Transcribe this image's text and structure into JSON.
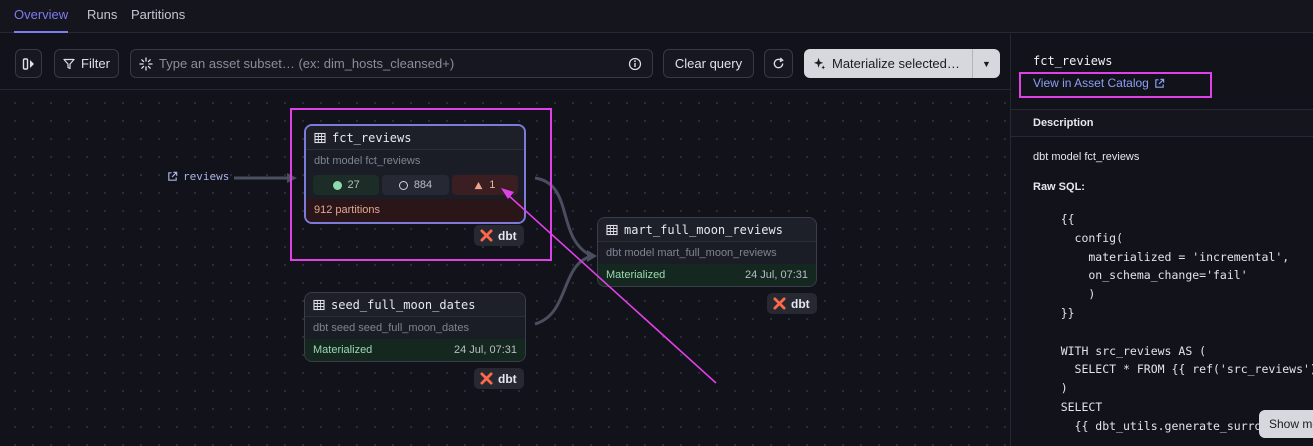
{
  "tabs": [
    {
      "label": "Overview",
      "active": true
    },
    {
      "label": "Runs",
      "active": false
    },
    {
      "label": "Partitions",
      "active": false
    }
  ],
  "toolbar": {
    "filter_label": "Filter",
    "search_placeholder": "Type an asset subset… (ex: dim_hosts_cleansed+)",
    "clear_label": "Clear query",
    "materialize_label": "Materialize selected…"
  },
  "graph": {
    "external_source": "reviews",
    "nodes": {
      "fct_reviews": {
        "name": "fct_reviews",
        "description": "dbt model fct_reviews",
        "stat_success": "27",
        "stat_missing": "884",
        "stat_failed": "1",
        "partitions": "912 partitions",
        "tag": "dbt"
      },
      "mart_full_moon_reviews": {
        "name": "mart_full_moon_reviews",
        "description": "dbt model mart_full_moon_reviews",
        "status": "Materialized",
        "time": "24 Jul, 07:31",
        "tag": "dbt"
      },
      "seed_full_moon_dates": {
        "name": "seed_full_moon_dates",
        "description": "dbt seed seed_full_moon_dates",
        "status": "Materialized",
        "time": "24 Jul, 07:31",
        "tag": "dbt"
      }
    }
  },
  "panel": {
    "title": "fct_reviews",
    "catalog_link": "View in Asset Catalog",
    "section_header": "Description",
    "description": "dbt model fct_reviews",
    "raw_sql_label": "Raw SQL:",
    "sql": "    {{\n      config(\n        materialized = 'incremental',\n        on_schema_change='fail'\n        )\n    }}\n\n    WITH src_reviews AS (\n      SELECT * FROM {{ ref('src_reviews') }}\n    )\n    SELECT\n      {{ dbt_utils.generate_surrogate_key(",
    "show_more": "Show more"
  },
  "colors": {
    "accent": "#7f7bf0",
    "annotation": "#e040e8",
    "success": "#9ad8b0",
    "failure": "#e4a692"
  }
}
